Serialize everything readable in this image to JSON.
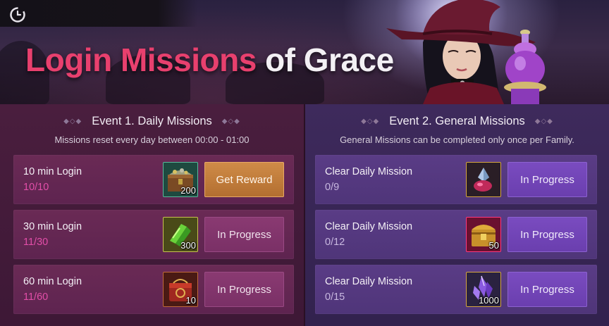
{
  "banner": {
    "title_part1": "Login Missions",
    "title_part2": "of Grace"
  },
  "icons": {
    "clock": "clock-icon"
  },
  "event1": {
    "title": "Event 1. Daily Missions",
    "subtitle": "Missions reset every day between 00:00 - 01:00",
    "missions": [
      {
        "name": "10 min Login",
        "progress": "10/10",
        "reward_qty": "200",
        "button": "Get Reward",
        "reward_icon": "treasure-chest-icon"
      },
      {
        "name": "30 min Login",
        "progress": "11/30",
        "reward_qty": "300",
        "button": "In Progress",
        "reward_icon": "green-crystal-icon"
      },
      {
        "name": "60 min Login",
        "progress": "11/60",
        "reward_qty": "10",
        "button": "In Progress",
        "reward_icon": "red-box-icon"
      }
    ]
  },
  "event2": {
    "title": "Event 2. General Missions",
    "subtitle": "General Missions can be completed only once per Family.",
    "missions": [
      {
        "name": "Clear Daily Mission",
        "progress": "0/9",
        "reward_qty": "",
        "button": "In Progress",
        "reward_icon": "crystal-gem-icon"
      },
      {
        "name": "Clear Daily Mission",
        "progress": "0/12",
        "reward_qty": "50",
        "button": "In Progress",
        "reward_icon": "golden-chest-icon"
      },
      {
        "name": "Clear Daily Mission",
        "progress": "0/15",
        "reward_qty": "1000",
        "button": "In Progress",
        "reward_icon": "purple-crystal-icon"
      }
    ]
  },
  "colors": {
    "accent_pink": "#e8406e",
    "reward_button": "#c07c3c",
    "left_panel": "#4a1e3e",
    "right_panel": "#3e2a5c"
  }
}
